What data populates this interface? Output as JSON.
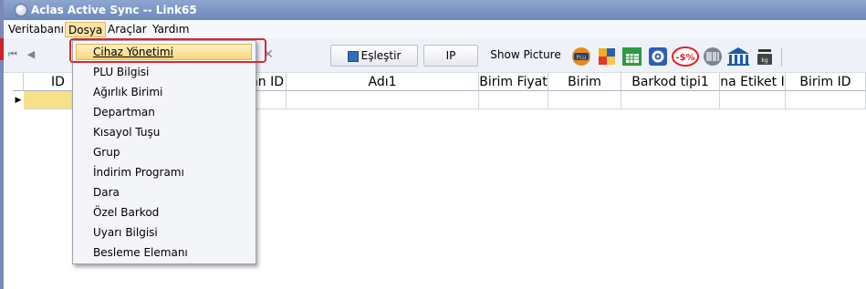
{
  "window": {
    "title": "Aclas Active Sync -- Link65"
  },
  "menubar": {
    "items": [
      "Veritabanı",
      "Dosya",
      "Araçlar",
      "Yardım"
    ]
  },
  "toolbar": {
    "first": "⏮",
    "prev": "◀",
    "clear": "✕",
    "match_label": "Eşleştir",
    "ip_label": "IP",
    "show_picture_label": "Show Picture"
  },
  "grid": {
    "columns": [
      "ID",
      "an ID",
      "Adı1",
      "Birim Fiyat",
      "Birim",
      "Barkod tipi1",
      "na Etiket I",
      "Birim ID"
    ]
  },
  "dosya_menu": {
    "items": [
      "Cihaz Yönetimi",
      "PLU Bilgisi",
      "Ağırlık Birimi",
      "Departman",
      "Kısayol Tuşu",
      "Grup",
      "İndirim Programı",
      "Dara",
      "Özel Barkod",
      "Uyarı Bilgisi",
      "Besleme Elemanı"
    ]
  },
  "colors": {
    "highlight": "#e0252d",
    "title": "#7b93c4"
  },
  "icons": [
    "app-icon",
    "plu-icon",
    "color-icon",
    "spreadsheet-icon",
    "settings-icon",
    "discount-icon",
    "barcode-icon",
    "bank-icon",
    "scale-icon"
  ]
}
